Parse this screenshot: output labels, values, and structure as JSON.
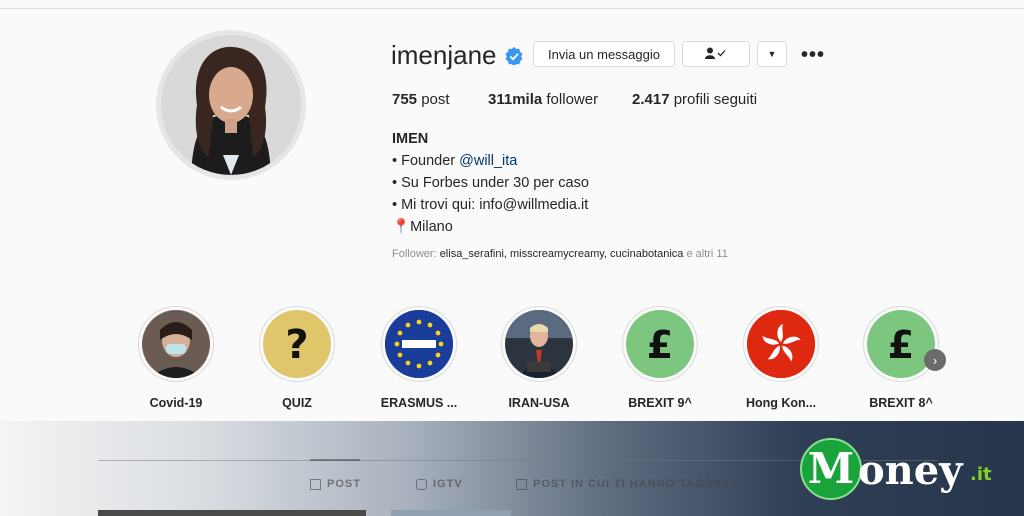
{
  "profile": {
    "username": "imenjane",
    "message_button": "Invia un messaggio",
    "follow_icon": "person-check-icon",
    "more_label": "•••",
    "stats": {
      "posts_count": "755",
      "posts_label": "post",
      "followers_count": "311mila",
      "followers_label": "follower",
      "following_count": "2.417",
      "following_label": "profili seguiti"
    },
    "bio": {
      "name": "IMEN",
      "line1_prefix": "• Founder ",
      "line1_mention": "@will_ita",
      "line2": "• Su Forbes under 30 per caso",
      "line3": "• Mi trovi qui: info@willmedia.it",
      "line4_icon": "📍",
      "line4": "Milano"
    },
    "followed_by": {
      "prefix": "Follower: ",
      "names": "elisa_serafini, misscreamycreamy, cucinabotanica",
      "suffix": " e altri 11"
    }
  },
  "highlights": [
    {
      "label": "Covid-19",
      "icon": "selfie-photo"
    },
    {
      "label": "QUIZ",
      "icon": "question-mark"
    },
    {
      "label": "ERASMUS ...",
      "icon": "erasmus-eu-flag"
    },
    {
      "label": "IRAN-USA",
      "icon": "news-photo"
    },
    {
      "label": "BREXIT 9^",
      "icon": "pound-sign"
    },
    {
      "label": "Hong Kon...",
      "icon": "hong-kong-flag"
    },
    {
      "label": "BREXIT 8^",
      "icon": "pound-sign"
    }
  ],
  "tabs": {
    "post": "POST",
    "igtv": "IGTV",
    "tagged": "POST IN CUI TI HANNO TAGGATO"
  },
  "watermark": {
    "text": "oney",
    "initial": "M",
    "suffix": ".it"
  },
  "colors": {
    "verified": "#3897f0",
    "mention": "#00376b",
    "pound_bg": "#7dc67f",
    "quiz_bg": "#e0c66a",
    "erasmus_bg": "#1a3d9c",
    "hongkong_bg": "#de2910",
    "logo_green": "#1aa33a"
  }
}
